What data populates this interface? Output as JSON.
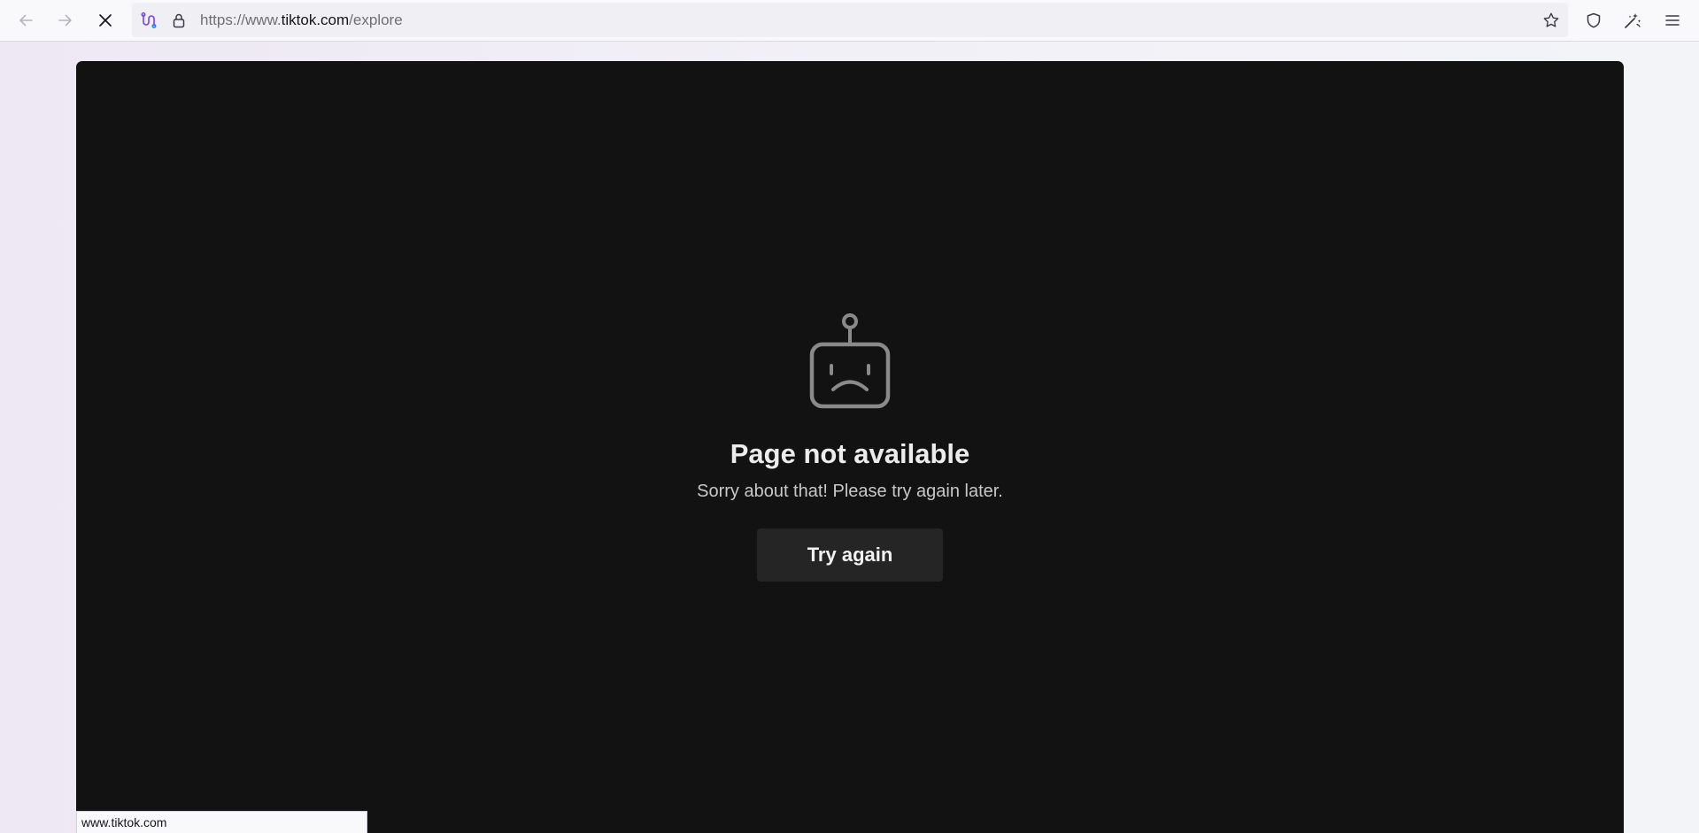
{
  "browser": {
    "url_prefix": "https://www.",
    "url_domain": "tiktok.com",
    "url_path": "/explore",
    "status_url": "www.tiktok.com",
    "icons": {
      "back": "back-arrow-icon",
      "forward": "forward-arrow-icon",
      "stop": "stop-loading-icon",
      "permissions": "site-permissions-icon",
      "lock": "lock-icon",
      "bookmark": "bookmark-star-icon",
      "tracking_protection": "shield-icon",
      "extensions": "customize-wand-icon",
      "menu": "hamburger-menu-icon"
    }
  },
  "error": {
    "icon": "sad-robot-icon",
    "title": "Page not available",
    "subtitle": "Sorry about that! Please try again later.",
    "button_label": "Try again"
  },
  "colors": {
    "page_background": "#121212",
    "button_background": "#252525",
    "icon_stroke": "#8a8a8a",
    "permissions_accent": "#7542e5"
  }
}
